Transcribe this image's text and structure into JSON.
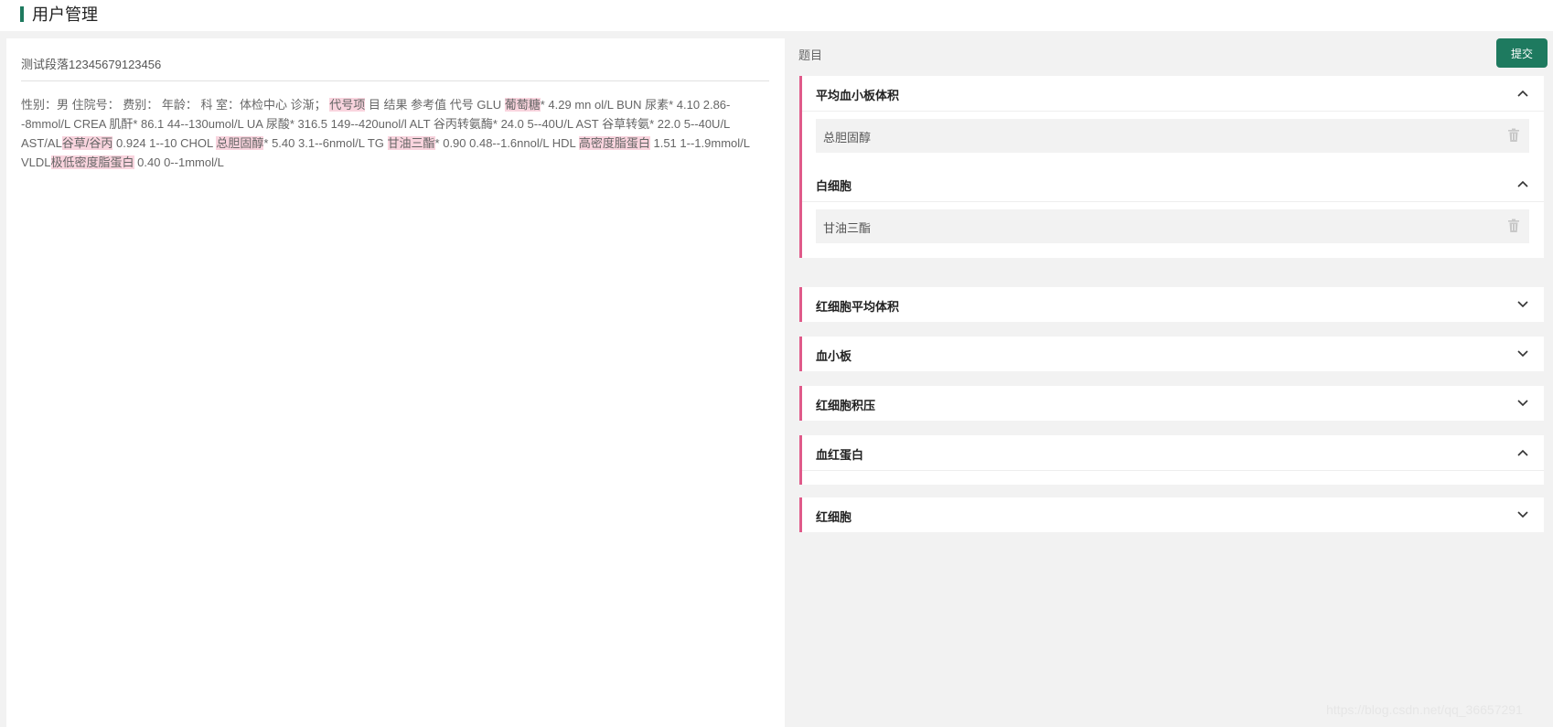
{
  "header": {
    "title": "用户管理"
  },
  "left": {
    "paragraph_title": "测试段落12345679123456",
    "segments": [
      {
        "text": "性别：男 住院号： 费别： 年龄： 科 室：体检中心 诊渐； ",
        "hl": false
      },
      {
        "text": "代号项",
        "hl": true
      },
      {
        "text": " 目 结果 参考值 代号 GLU ",
        "hl": false
      },
      {
        "text": "葡萄糖",
        "hl": true
      },
      {
        "text": "* 4.29 mn ol/L BUN 尿素* 4.10 2.86--8mmol/L CREA 肌酐* 86.1 44--130umol/L UA 尿酸* 316.5 149--420unol/l ALT 谷丙转氨酶* 24.0 5--40U/L AST 谷草转氨* 22.0 5--40U/L AST/AL",
        "hl": false
      },
      {
        "text": "谷草/谷丙",
        "hl": true
      },
      {
        "text": " 0.924 1--10 CHOL ",
        "hl": false
      },
      {
        "text": "总胆固醇",
        "hl": true
      },
      {
        "text": "* 5.40 3.1--6nmol/L TG ",
        "hl": false
      },
      {
        "text": "甘油三酯",
        "hl": true
      },
      {
        "text": "* 0.90 0.48--1.6nnol/L HDL ",
        "hl": false
      },
      {
        "text": "高密度脂蛋白",
        "hl": true
      },
      {
        "text": " 1.51 1--1.9mmol/L VLDL",
        "hl": false
      },
      {
        "text": "极低密度脂蛋白",
        "hl": true
      },
      {
        "text": " 0.40 0--1mmol/L",
        "hl": false
      }
    ]
  },
  "right": {
    "title": "题目",
    "submit_label": "提交",
    "sections": [
      {
        "label": "平均血小板体积",
        "expanded": true,
        "items": [
          "总胆固醇"
        ]
      },
      {
        "label": "白细胞",
        "expanded": true,
        "items": [
          "甘油三酯"
        ]
      },
      {
        "label": "红细胞平均体积",
        "expanded": false,
        "items": []
      },
      {
        "label": "血小板",
        "expanded": false,
        "items": []
      },
      {
        "label": "红细胞积压",
        "expanded": false,
        "items": []
      },
      {
        "label": "血红蛋白",
        "expanded": true,
        "items": []
      },
      {
        "label": "红细胞",
        "expanded": false,
        "items": []
      }
    ]
  },
  "colors": {
    "accent": "#1e7a5f",
    "section_border": "#e05a8a",
    "highlight": "#f9d4de"
  },
  "icons": {
    "collapse": "chevron-up-icon",
    "expand": "chevron-down-icon",
    "delete": "trash-icon"
  },
  "watermark": "https://blog.csdn.net/qq_36657291"
}
